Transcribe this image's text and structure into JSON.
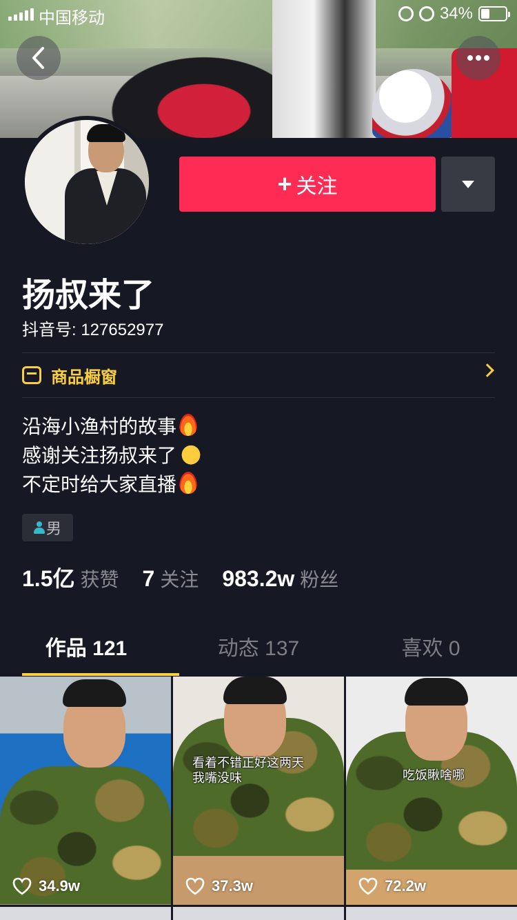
{
  "status_bar": {
    "carrier": "中国移动",
    "battery": "34%"
  },
  "header": {
    "back_icon": "chevron-left-icon",
    "more_icon": "more-horizontal-icon"
  },
  "actions": {
    "follow_label": "关注",
    "follow_prefix": "+",
    "follow_color": "#fe2c55"
  },
  "profile": {
    "name": "扬叔来了",
    "douyin_id": "抖音号: 127652977",
    "shop_label": "商品橱窗",
    "bio": [
      "沿海小渔村的故事",
      "感谢关注扬叔来了",
      "不定时给大家直播"
    ],
    "gender": "男"
  },
  "stats": [
    {
      "value": "1.5亿",
      "label": "获赞"
    },
    {
      "value": "7",
      "label": "关注"
    },
    {
      "value": "983.2w",
      "label": "粉丝"
    }
  ],
  "tabs": [
    {
      "label": "作品 121",
      "active": true
    },
    {
      "label": "动态 137",
      "active": false
    },
    {
      "label": "喜欢 0",
      "active": false
    }
  ],
  "accent_color": "#facf3f",
  "videos": [
    {
      "likes": "34.9w",
      "caption": []
    },
    {
      "likes": "37.3w",
      "caption": [
        "看着不错正好这两天",
        "我嘴没味"
      ]
    },
    {
      "likes": "72.2w",
      "caption": [
        "吃饭瞅啥哪"
      ]
    }
  ]
}
